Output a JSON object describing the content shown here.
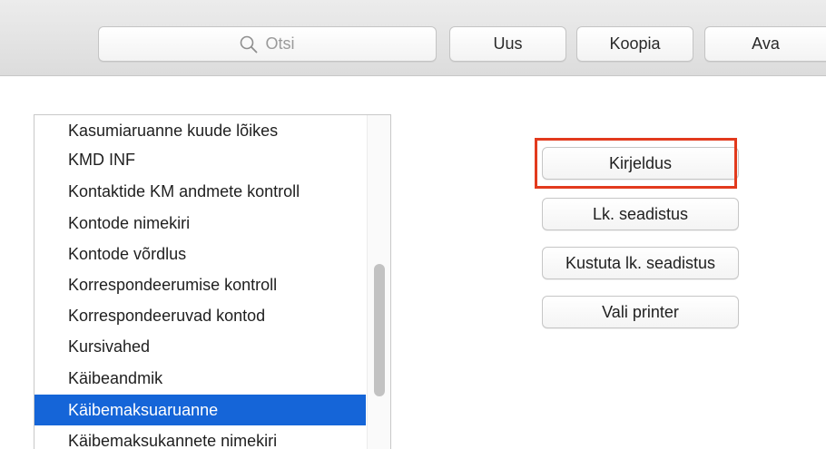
{
  "toolbar": {
    "search_placeholder": "Otsi",
    "new_label": "Uus",
    "copy_label": "Koopia",
    "open_label": "Ava"
  },
  "report_list": {
    "items": [
      {
        "label": "Kasumiaruanne kuude lõikes"
      },
      {
        "label": "KMD INF"
      },
      {
        "label": "Kontaktide KM andmete kontroll"
      },
      {
        "label": "Kontode nimekiri"
      },
      {
        "label": "Kontode võrdlus"
      },
      {
        "label": "Korrespondeerumise kontroll"
      },
      {
        "label": "Korrespondeeruvad kontod"
      },
      {
        "label": "Kursivahed"
      },
      {
        "label": "Käibeandmik"
      },
      {
        "label": "Käibemaksuaruanne",
        "selected": true
      },
      {
        "label": "Käibemaksukannete nimekiri"
      }
    ]
  },
  "actions": {
    "description_label": "Kirjeldus",
    "page_setup_label": "Lk. seadistus",
    "delete_page_setup_label": "Kustuta lk. seadistus",
    "choose_printer_label": "Vali printer"
  },
  "colors": {
    "selection": "#1565d8",
    "highlight_frame": "#e23a1d"
  }
}
